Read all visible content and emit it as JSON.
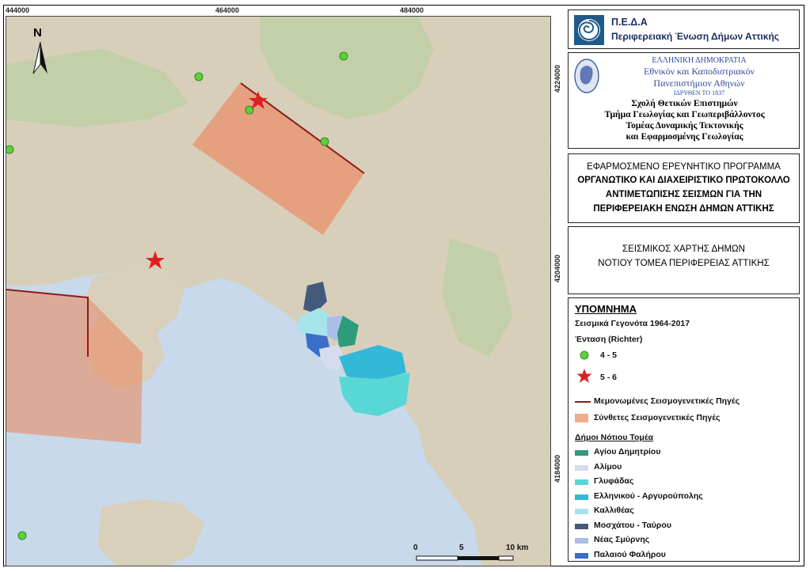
{
  "map": {
    "x_ticks": [
      "444000",
      "464000",
      "484000"
    ],
    "y_ticks": [
      "4224000",
      "4204000",
      "4184000"
    ],
    "north_label": "N",
    "scale_labels": [
      "0",
      "5",
      "10 km"
    ],
    "colors": {
      "sea": "#c7d9ea",
      "land": "#d9d0bc",
      "forest": "#c3cfa8",
      "source_fill": "#e8906b",
      "fault_line": "#8b1a1a",
      "event_4_5": "#5ad33a",
      "event_5_6": "#e01e1e"
    }
  },
  "header": {
    "org_short": "Π.Ε.Δ.Α",
    "org_full": "Περιφερειακή Ένωση Δήμων Αττικής"
  },
  "university": {
    "line1": "ΕΛΛΗΝΙΚΗ ΔΗΜΟΚΡΑΤΙΑ",
    "line2": "Εθνικόν και Καποδιστριακόν",
    "line3": "Πανεπιστήμιον Αθηνών",
    "line4": "ΙΔΡΥΘΕΝ ΤΟ 1837",
    "school": "Σχολή Θετικών Επιστημών",
    "department": "Τμήμα Γεωλογίας και Γεωπεριβάλλοντος",
    "sector1": "Τομέας Δυναμικής Τεκτονικής",
    "sector2": "και Εφαρμοσμένης Γεωλογίας"
  },
  "program": {
    "line1": "ΕΦΑΡΜΟΣΜΕΝΟ ΕΡΕΥΝΗΤΙΚΟ ΠΡΟΓΡΑΜΜΑ",
    "line2": "ΟΡΓΑΝΩΤΙΚΟ ΚΑΙ ΔΙΑΧΕΙΡΙΣΤΙΚΟ ΠΡΩΤΟΚΟΛΛΟ",
    "line3": "ΑΝΤΙΜΕΤΩΠΙΣΗΣ ΣΕΙΣΜΩΝ ΓΙΑ ΤΗΝ",
    "line4": "ΠΕΡΙΦΕΡΕΙΑΚΗ ΕΝΩΣΗ ΔΗΜΩΝ ΑΤΤΙΚΗΣ"
  },
  "map_title": {
    "line1": "ΣΕΙΣΜΙΚΟΣ ΧΑΡΤΗΣ ΔΗΜΩΝ",
    "line2": "ΝΟΤΙΟΥ ΤΟΜΕΑ ΠΕΡΙΦΕΡΕΙΑΣ ΑΤΤΙΚΗΣ"
  },
  "legend": {
    "title": "ΥΠΟΜΝΗΜΑ",
    "events_title": "Σεισμικά Γεγονότα 1964-2017",
    "intensity_label": "Ένταση (Richter)",
    "class_4_5": "4 - 5",
    "class_5_6": "5 - 6",
    "single_sources": "Μεμονωμένες Σεισμογενετικές Πηγές",
    "composite_sources": "Σύνθετες Σεισμογενετικές Πηγές",
    "municipalities_title": "Δήμοι Νότιου Τομέα",
    "municipalities": [
      {
        "name": "Αγίου Δημητρίου",
        "color": "#2e9b7a"
      },
      {
        "name": "Αλίμου",
        "color": "#d6dcef"
      },
      {
        "name": "Γλυφάδας",
        "color": "#58d7d4"
      },
      {
        "name": "Ελληνικού - Αργυρούπολης",
        "color": "#33b9d8"
      },
      {
        "name": "Καλλιθέας",
        "color": "#a6e4ec"
      },
      {
        "name": "Μοσχάτου - Ταύρου",
        "color": "#435a7c"
      },
      {
        "name": "Νέας Σμύρνης",
        "color": "#a9bfe8"
      },
      {
        "name": "Παλαιού Φαλήρου",
        "color": "#3a6ec9"
      }
    ]
  }
}
